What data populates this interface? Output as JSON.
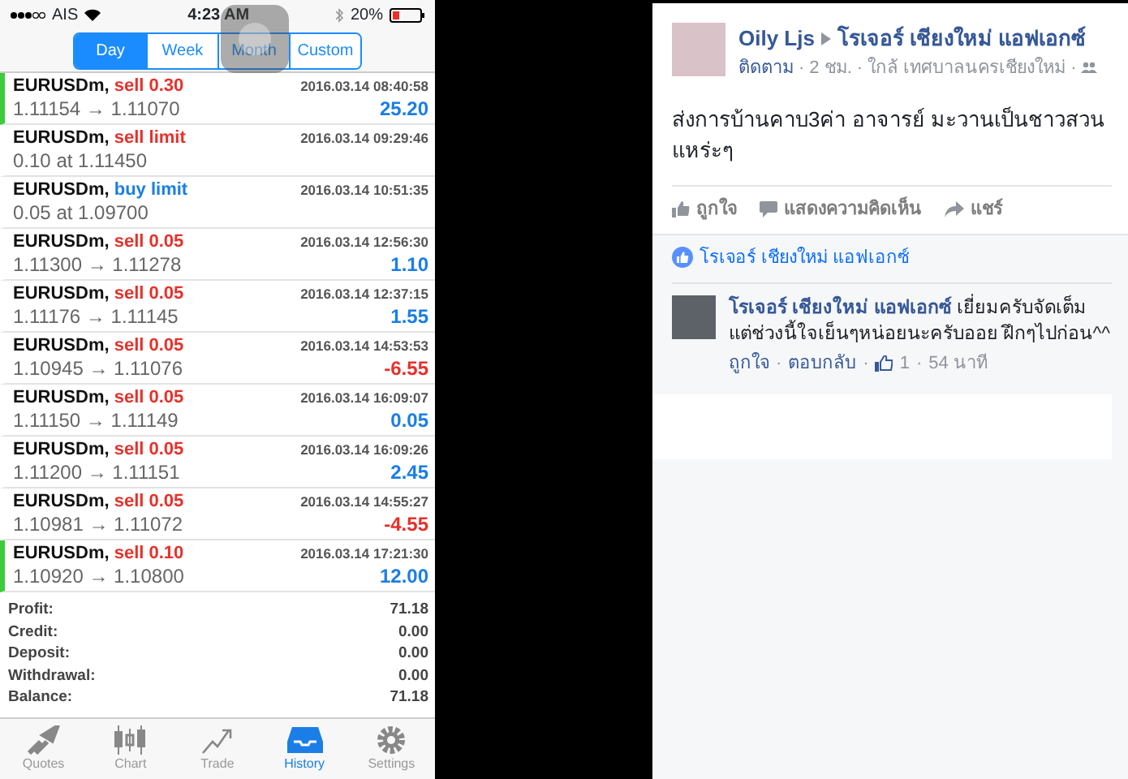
{
  "status_bar": {
    "carrier": "AIS",
    "time": "4:23 AM",
    "battery": "20%"
  },
  "segments": [
    {
      "label": "Day",
      "selected": true
    },
    {
      "label": "Week",
      "selected": false
    },
    {
      "label": "Month",
      "selected": false
    },
    {
      "label": "Custom",
      "selected": false
    }
  ],
  "trades": [
    {
      "symbol": "EURUSDm,",
      "order": {
        "text": "sell 0.30",
        "color": "#e8302a"
      },
      "time": "2016.03.14 08:40:58",
      "prices": "1.11154 → 1.11070",
      "result": {
        "text": "25.20",
        "color": "#1a7ee6"
      },
      "marked": true
    },
    {
      "symbol": "EURUSDm,",
      "order": {
        "text": "sell limit",
        "color": "#e8302a"
      },
      "time": "2016.03.14 09:29:46",
      "prices": "0.10 at 1.11450",
      "marked": false
    },
    {
      "symbol": "EURUSDm,",
      "order": {
        "text": "buy limit",
        "color": "#1a7ee6"
      },
      "time": "2016.03.14 10:51:35",
      "prices": "0.05 at 1.09700",
      "marked": false
    },
    {
      "symbol": "EURUSDm,",
      "order": {
        "text": "sell 0.05",
        "color": "#e8302a"
      },
      "time": "2016.03.14 12:56:30",
      "prices": "1.11300 → 1.11278",
      "result": {
        "text": "1.10",
        "color": "#1a7ee6"
      },
      "marked": false
    },
    {
      "symbol": "EURUSDm,",
      "order": {
        "text": "sell 0.05",
        "color": "#e8302a"
      },
      "time": "2016.03.14 12:37:15",
      "prices": "1.11176 → 1.11145",
      "result": {
        "text": "1.55",
        "color": "#1a7ee6"
      },
      "marked": false
    },
    {
      "symbol": "EURUSDm,",
      "order": {
        "text": "sell 0.05",
        "color": "#e8302a"
      },
      "time": "2016.03.14 14:53:53",
      "prices": "1.10945 → 1.11076",
      "result": {
        "text": "-6.55",
        "color": "#e8302a"
      },
      "marked": false
    },
    {
      "symbol": "EURUSDm,",
      "order": {
        "text": "sell 0.05",
        "color": "#e8302a"
      },
      "time": "2016.03.14 16:09:07",
      "prices": "1.11150 → 1.11149",
      "result": {
        "text": "0.05",
        "color": "#1a7ee6"
      },
      "marked": false
    },
    {
      "symbol": "EURUSDm,",
      "order": {
        "text": "sell 0.05",
        "color": "#e8302a"
      },
      "time": "2016.03.14 16:09:26",
      "prices": "1.11200 → 1.11151",
      "result": {
        "text": "2.45",
        "color": "#1a7ee6"
      },
      "marked": false
    },
    {
      "symbol": "EURUSDm,",
      "order": {
        "text": "sell 0.05",
        "color": "#e8302a"
      },
      "time": "2016.03.14 14:55:27",
      "prices": "1.10981 → 1.11072",
      "result": {
        "text": "-4.55",
        "color": "#e8302a"
      },
      "marked": false
    },
    {
      "symbol": "EURUSDm,",
      "order": {
        "text": "sell 0.10",
        "color": "#e8302a"
      },
      "time": "2016.03.14 17:21:30",
      "prices": "1.10920 → 1.10800",
      "result": {
        "text": "12.00",
        "color": "#1a7ee6"
      },
      "marked": true
    }
  ],
  "summary": [
    {
      "label": "Profit:",
      "value": "71.18"
    },
    {
      "label": "Credit:",
      "value": "0.00"
    },
    {
      "label": "Deposit:",
      "value": "0.00"
    },
    {
      "label": "Withdrawal:",
      "value": "0.00"
    },
    {
      "label": "Balance:",
      "value": "71.18"
    }
  ],
  "tab_bar": [
    {
      "label": "Quotes",
      "kind": "quotes",
      "selected": false
    },
    {
      "label": "Chart",
      "kind": "chart",
      "selected": false
    },
    {
      "label": "Trade",
      "kind": "trade",
      "selected": false
    },
    {
      "label": "History",
      "kind": "history",
      "selected": true
    },
    {
      "label": "Settings",
      "kind": "settings",
      "selected": false
    }
  ],
  "post": {
    "author": "Oily Ljs",
    "target": "โรเจอร์ เชียงใหม่ แอฟเอกซ์",
    "meta": [
      {
        "text": "ติดตาม",
        "kind": "link"
      },
      {
        "text": "·",
        "kind": "dot"
      },
      {
        "text": "2 ชม.",
        "kind": "text"
      },
      {
        "text": "·",
        "kind": "dot"
      },
      {
        "text": "ใกล้ เทศบาลนครเชียงใหม่",
        "kind": "text"
      },
      {
        "text": "·",
        "kind": "dot"
      }
    ],
    "text": "ส่งการบ้านคาบ3ค่า อาจารย์ มะวานเป็นชาวสวน แหร่ะๆ",
    "actions": [
      {
        "label": "ถูกใจ",
        "kind": "like"
      },
      {
        "label": "แสดงความคิดเห็น",
        "kind": "comment"
      },
      {
        "label": "แชร์",
        "kind": "share"
      }
    ]
  },
  "likes": "โรเจอร์ เชียงใหม่ แอฟเอกซ์",
  "comment": {
    "author": "โรเจอร์ เชียงใหม่ แอฟเอกซ์",
    "text": "เยี่ยมครับจัดเต็ม แต่ช่วงนี้ใจเย็นๆหน่อยนะครับออย ฝึกๆไปก่อน^^",
    "meta": [
      {
        "text": "ถูกใจ",
        "kind": "link"
      },
      {
        "text": "·",
        "kind": "dot"
      },
      {
        "text": "ตอบกลับ",
        "kind": "link"
      },
      {
        "text": "·",
        "kind": "dot"
      },
      {
        "text": "1",
        "kind": "likes"
      },
      {
        "text": "·",
        "kind": "dot"
      },
      {
        "text": "54 นาที",
        "kind": "text"
      }
    ]
  }
}
